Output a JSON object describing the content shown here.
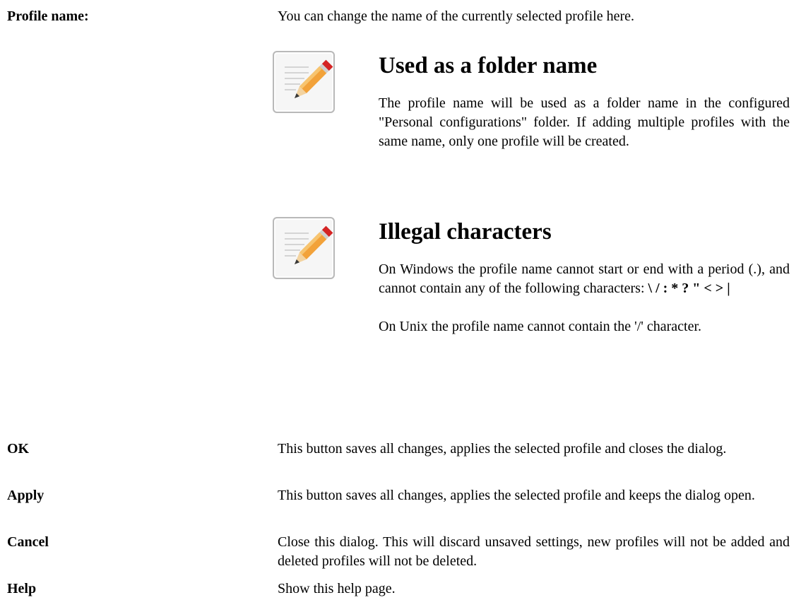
{
  "entries": [
    {
      "term": "Profile name:",
      "definition": "You can change the name of the currently selected profile here."
    },
    {
      "term": "OK",
      "definition": "This button saves all changes, applies the selected profile and closes the dialog."
    },
    {
      "term": "Apply",
      "definition": "This button saves all changes, applies the selected profile and keeps the dialog open."
    },
    {
      "term": "Cancel",
      "definition": "Close this dialog. This will discard unsaved settings, new profiles will not be added and deleted profiles will not be deleted."
    },
    {
      "term": "Help",
      "definition": "Show this help page."
    }
  ],
  "notes": [
    {
      "icon": "note-pencil-icon",
      "title": "Used as a folder name",
      "text": "The profile name will be used as a folder name in the configured \"Personal configurations\" folder. If adding multiple profiles with the same name, only one profile will be created."
    },
    {
      "icon": "note-pencil-icon",
      "title": "Illegal characters",
      "text_before": "On Windows the profile name cannot start or end with a period (.), and cannot contain any of the following characters: ",
      "text_chars": "\\ / : * ? \" < > |",
      "text_unix": "On Unix the profile name cannot contain the '/' character."
    }
  ]
}
